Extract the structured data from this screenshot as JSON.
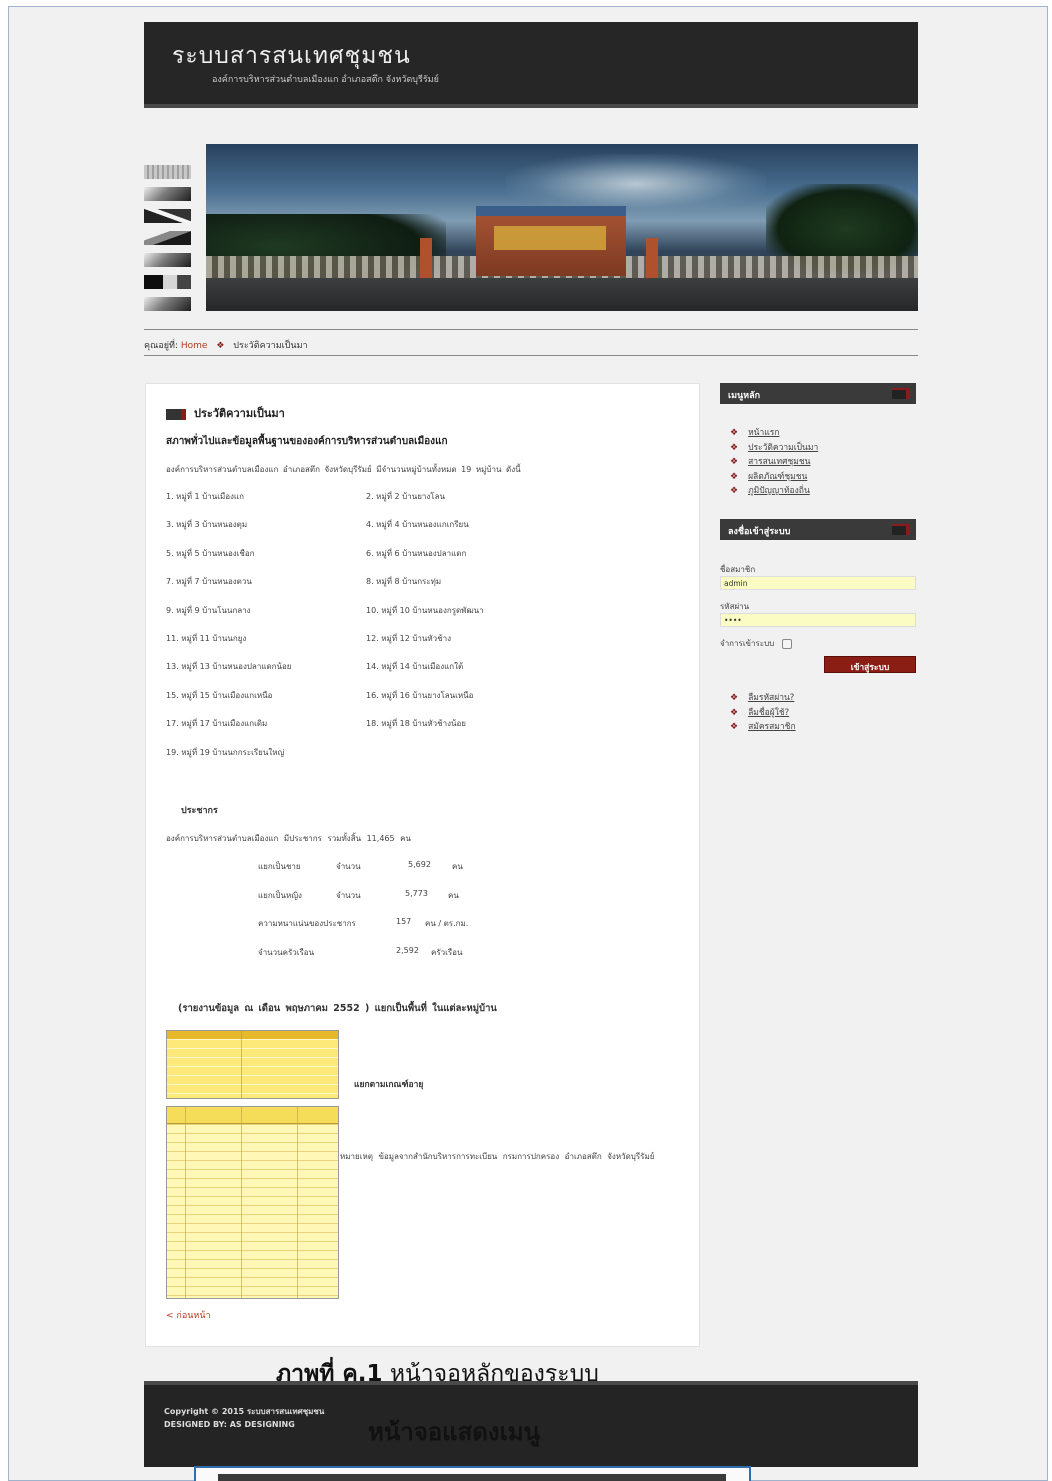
{
  "header": {
    "title": "ระบบสารสนเทศชุมชน",
    "subtitle": "องค์การบริหารส่วนตำบลเมืองแก อำเภอสตึก จังหวัดบุรีรัมย์"
  },
  "breadcrumb": {
    "prefix": "คุณอยู่ที่:",
    "home": "Home",
    "separator": "❖",
    "current": "ประวัติความเป็นมา"
  },
  "content": {
    "page_title": "ประวัติความเป็นมา",
    "section_title": "สภาพทั่วไปและข้อมูลพื้นฐานขององค์การบริหารส่วนตำบลเมืองแก",
    "intro": "องค์การบริหารส่วนตำบลเมืองแก อำเภอสตึก จังหวัดบุรีรัมย์ มีจำนวนหมู่บ้านทั้งหมด 19 หมู่บ้าน ดังนี้",
    "villages": [
      [
        "1.    หมู่ที่ 1 บ้านเมืองแก",
        "2.    หมู่ที่ 2 บ้านยางโลน"
      ],
      [
        "3.    หมู่ที่ 3 บ้านหนองตุม",
        "4.    หมู่ที่ 4 บ้านหนองแกเกรียน"
      ],
      [
        "5.    หมู่ที่ 5 บ้านหนองเชือก",
        "6.    หมู่ที่ 6 บ้านหนองปลาแดก"
      ],
      [
        "7.    หมู่ที่ 7 บ้านหนองตวน",
        "8.    หมู่ที่ 8 บ้านกระทุ่ม"
      ],
      [
        "9.    หมู่ที่ 9 บ้านโนนกลาง",
        "10.  หมู่ที่ 10 บ้านหนองกรูดพัฒนา"
      ],
      [
        "11.  หมู่ที่ 11 บ้านนกยูง",
        "12.  หมู่ที่ 12 บ้านหัวช้าง"
      ],
      [
        "13.  หมู่ที่ 13 บ้านหนองปลาแดกน้อย",
        "14.  หมู่ที่ 14 บ้านเมืองแกใต้"
      ],
      [
        "15.  หมู่ที่ 15 บ้านเมืองแกเหนือ",
        "16.  หมู่ที่ 16 บ้านยางโลนเหนือ"
      ],
      [
        "17.  หมู่ที่ 17 บ้านเมืองแกเดิม",
        "18.  หมู่ที่ 18 บ้านหัวช้างน้อย"
      ],
      [
        "19.  หมู่ที่ 19 บ้านนกกระเรียนใหญ่",
        ""
      ]
    ],
    "population_title": "ประชากร",
    "population_total": "องค์การบริหารส่วนตำบลเมืองแก มีประชากร รวมทั้งสิ้น 11,465 คน",
    "stats": [
      {
        "label": "แยกเป็นชาย",
        "word": "จำนวน",
        "value": "5,692",
        "unit": "คน"
      },
      {
        "label": "แยกเป็นหญิง",
        "word": "จำนวน",
        "value": "5,773",
        "unit": "คน"
      },
      {
        "label": "ความหนาแน่นของประชากร",
        "word": "",
        "value": "157",
        "unit": "คน / ตร.กม."
      },
      {
        "label": "จำนวนครัวเรือน",
        "word": "",
        "value": "2,592",
        "unit": "ครัวเรือน"
      }
    ],
    "report_title": "(รายงานข้อมูล ณ เดือน พฤษภาคม 2552 ) แยกเป็นพื้นที่ ในแต่ละหมู่บ้าน",
    "table1_label": "แยกตามเกณฑ์อายุ",
    "note": "หมายเหตุ   ข้อมูลจากสำนักบริหารการทะเบียน กรมการปกครอง อำเภอสตึก จังหวัดบุรีรัมย์",
    "back_link": "< ก่อนหน้า"
  },
  "sidebar": {
    "menu_title": "เมนูหลัก",
    "menu_items": [
      "หน้าแรก",
      "ประวัติความเป็นมา",
      "สารสนเทศชุมชน",
      "ผลิตภัณฑ์ชุมชน",
      "ภูมิปัญญาท้องถิ่น"
    ],
    "login_title": "ลงชื่อเข้าสู่ระบบ",
    "username_label": "ชื่อสมาชิก",
    "username_value": "admin",
    "password_label": "รหัสผ่าน",
    "password_value": "••••",
    "remember_label": "จำการเข้าระบบ",
    "login_button": "เข้าสู่ระบบ",
    "links": [
      "ลืมรหัสผ่าน?",
      "ลืมชื่อผู้ใช้?",
      "สมัครสมาชิก"
    ],
    "bullet": "❖"
  },
  "caption": {
    "bold": "ภาพที่ ค.1",
    "rest": " หน้าจอหลักของระบบ"
  },
  "footer": {
    "copyright": "Copyright © 2015 ระบบสารสนเทศชุมชน",
    "designed": "DESIGNED BY:  AS DESIGNING",
    "caption": "หน้าจอแสดงเมนู"
  }
}
